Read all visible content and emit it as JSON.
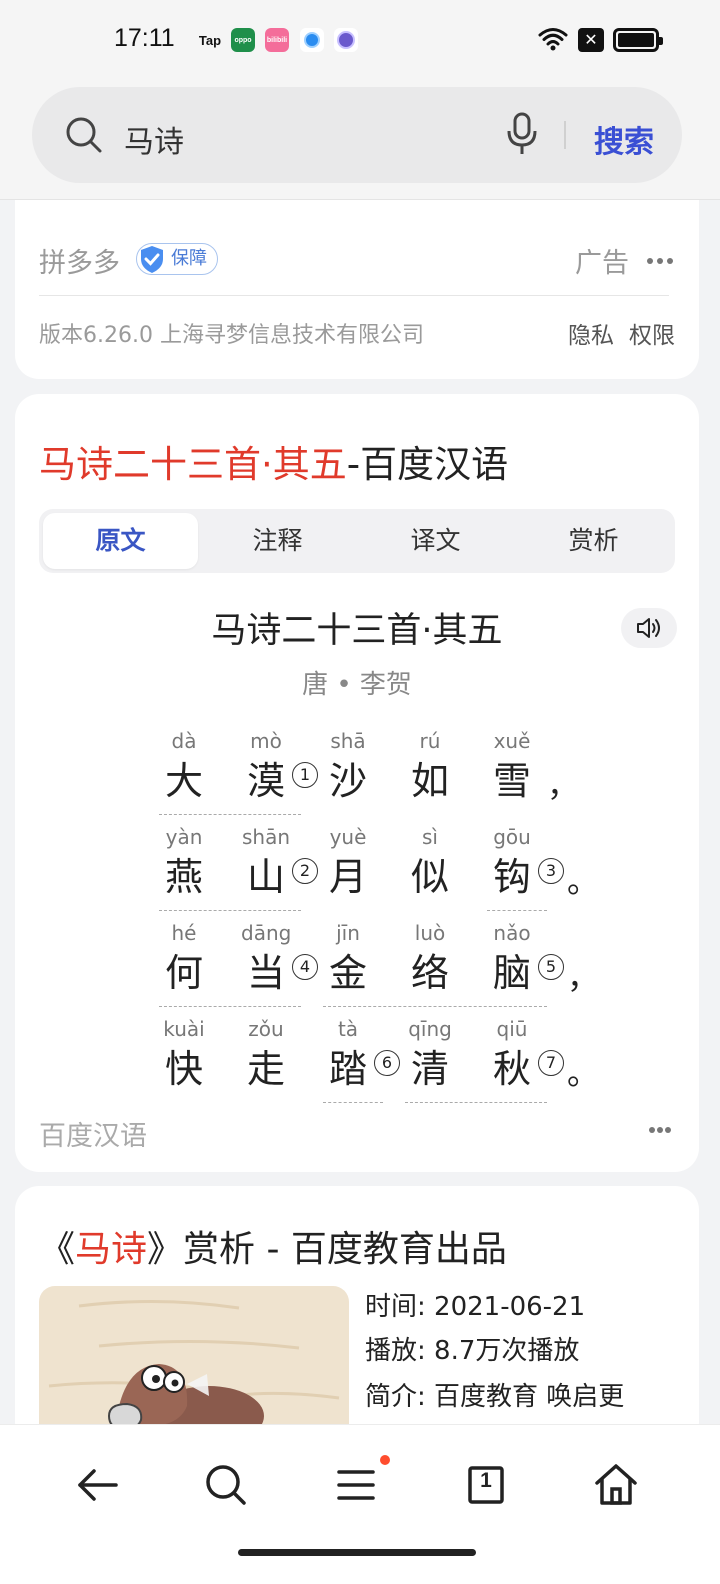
{
  "status_bar": {
    "time": "17:11",
    "app_icons": [
      "Tap",
      "oppo",
      "bilibili"
    ],
    "icons": [
      "wifi-icon",
      "x-icon",
      "battery-icon"
    ]
  },
  "search": {
    "query": "马诗",
    "button": "搜索"
  },
  "ad_card": {
    "app_name": "拼多多",
    "guarantee_badge": "保障",
    "ad_label": "广告",
    "version_info": "版本6.26.0  上海寻梦信息技术有限公司",
    "privacy_link": "隐私",
    "permission_link": "权限"
  },
  "hanyu_card": {
    "title_highlight": "马诗二十三首·其五",
    "title_rest": "-百度汉语",
    "tabs": [
      "原文",
      "注释",
      "译文",
      "赏析"
    ],
    "active_tab": "原文",
    "poem_title": "马诗二十三首·其五",
    "author": "唐 • 李贺",
    "lines": [
      {
        "chars": [
          {
            "pinyin": "dà",
            "hanzi": "大"
          },
          {
            "pinyin": "mò",
            "hanzi": "漠",
            "note": "1"
          },
          {
            "pinyin": "shā",
            "hanzi": "沙"
          },
          {
            "pinyin": "rú",
            "hanzi": "如"
          },
          {
            "pinyin": "xuě",
            "hanzi": "雪"
          }
        ],
        "punct": "，"
      },
      {
        "chars": [
          {
            "pinyin": "yàn",
            "hanzi": "燕"
          },
          {
            "pinyin": "shān",
            "hanzi": "山",
            "note": "2"
          },
          {
            "pinyin": "yuè",
            "hanzi": "月"
          },
          {
            "pinyin": "sì",
            "hanzi": "似"
          },
          {
            "pinyin": "gōu",
            "hanzi": "钩",
            "note": "3"
          }
        ],
        "punct": "。"
      },
      {
        "chars": [
          {
            "pinyin": "hé",
            "hanzi": "何"
          },
          {
            "pinyin": "dāng",
            "hanzi": "当",
            "note": "4"
          },
          {
            "pinyin": "jīn",
            "hanzi": "金"
          },
          {
            "pinyin": "luò",
            "hanzi": "络"
          },
          {
            "pinyin": "nǎo",
            "hanzi": "脑",
            "note": "5"
          }
        ],
        "punct": "，"
      },
      {
        "chars": [
          {
            "pinyin": "kuài",
            "hanzi": "快"
          },
          {
            "pinyin": "zǒu",
            "hanzi": "走"
          },
          {
            "pinyin": "tà",
            "hanzi": "踏",
            "note": "6"
          },
          {
            "pinyin": "qīng",
            "hanzi": "清"
          },
          {
            "pinyin": "qiū",
            "hanzi": "秋",
            "note": "7"
          }
        ],
        "punct": "。"
      }
    ],
    "source": "百度汉语"
  },
  "analysis_card": {
    "title_open": "《",
    "title_highlight": "马诗",
    "title_rest": "》赏析 - 百度教育出品",
    "time_label": "时间:",
    "time_value": "2021-06-21",
    "plays_label": "播放:",
    "plays_value": "8.7万次播放",
    "intro_label": "简介:",
    "intro_value": "百度教育 唤启更"
  },
  "bottom_nav": {
    "items": [
      "back-icon",
      "search-icon",
      "menu-icon",
      "tabs-icon",
      "home-icon"
    ],
    "tab_count": "1"
  },
  "colors": {
    "accent": "#3a4fd4",
    "highlight": "#e03a2b",
    "notification": "#ff4d2e"
  }
}
